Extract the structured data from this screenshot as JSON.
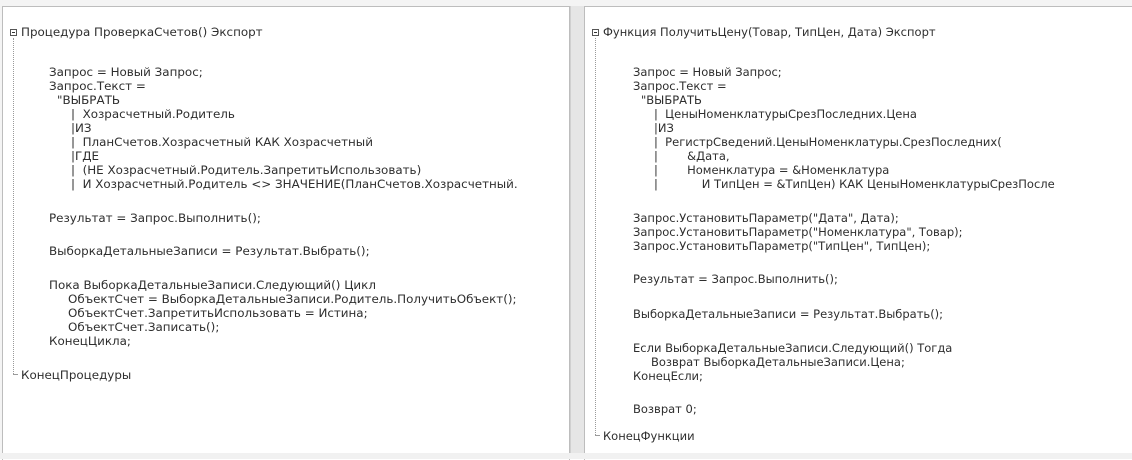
{
  "left_pane": {
    "lines": [
      {
        "text": "Процедура ПроверкаСчетов() Экспорт"
      },
      {
        "text": ""
      },
      {
        "text": "Запрос = Новый Запрос;"
      },
      {
        "text": "Запрос.Текст ="
      },
      {
        "text": "\"ВЫБРАТЬ"
      },
      {
        "text": "|  Хозрасчетный.Родитель"
      },
      {
        "text": "|ИЗ"
      },
      {
        "text": "|  ПланСчетов.Хозрасчетный КАК Хозрасчетный"
      },
      {
        "text": "|ГДЕ"
      },
      {
        "text": "|  (НЕ Хозрасчетный.Родитель.ЗапретитьИспользовать)"
      },
      {
        "text": "|  И Хозрасчетный.Родитель <> ЗНАЧЕНИЕ(ПланСчетов.Хозрасчетный."
      },
      {
        "text": ""
      },
      {
        "text": "Результат = Запрос.Выполнить();"
      },
      {
        "text": ""
      },
      {
        "text": "ВыборкаДетальныеЗаписи = Результат.Выбрать();"
      },
      {
        "text": ""
      },
      {
        "text": "Пока ВыборкаДетальныеЗаписи.Следующий() Цикл"
      },
      {
        "text": "ОбъектСчет = ВыборкаДетальныеЗаписи.Родитель.ПолучитьОбъект();"
      },
      {
        "text": "ОбъектСчет.ЗапретитьИспользовать = Истина;"
      },
      {
        "text": "ОбъектСчет.Записать();"
      },
      {
        "text": "КонецЦикла;"
      },
      {
        "text": ""
      },
      {
        "text": "КонецПроцедуры"
      }
    ]
  },
  "right_pane": {
    "lines": [
      {
        "text": "Функция ПолучитьЦену(Товар, ТипЦен, Дата) Экспорт"
      },
      {
        "text": ""
      },
      {
        "text": "Запрос = Новый Запрос;"
      },
      {
        "text": "Запрос.Текст ="
      },
      {
        "text": "\"ВЫБРАТЬ"
      },
      {
        "text": "|  ЦеныНоменклатурыСрезПоследних.Цена"
      },
      {
        "text": "|ИЗ"
      },
      {
        "text": "|  РегистрСведений.ЦеныНоменклатуры.СрезПоследних("
      },
      {
        "text": "|        &Дата,"
      },
      {
        "text": "|        Номенклатура = &Номенклатура"
      },
      {
        "text": "|            И ТипЦен = &ТипЦен) КАК ЦеныНоменклатурыСрезПосле"
      },
      {
        "text": ""
      },
      {
        "text": "Запрос.УстановитьПараметр(\"Дата\", Дата);"
      },
      {
        "text": "Запрос.УстановитьПараметр(\"Номенклатура\", Товар);"
      },
      {
        "text": "Запрос.УстановитьПараметр(\"ТипЦен\", ТипЦен);"
      },
      {
        "text": ""
      },
      {
        "text": "Результат = Запрос.Выполнить();"
      },
      {
        "text": ""
      },
      {
        "text": "ВыборкаДетальныеЗаписи = Результат.Выбрать();"
      },
      {
        "text": ""
      },
      {
        "text": "Если ВыборкаДетальныеЗаписи.Следующий() Тогда"
      },
      {
        "text": "Возврат ВыборкаДетальныеЗаписи.Цена;"
      },
      {
        "text": "КонецЕсли;"
      },
      {
        "text": ""
      },
      {
        "text": "Возврат 0;"
      },
      {
        "text": ""
      },
      {
        "text": "КонецФункции"
      }
    ]
  },
  "icons": {
    "fold_open": "minus-box-icon",
    "fold_end": "fold-end-icon"
  },
  "colors": {
    "background": "#ffffff",
    "text": "#2e2e2e",
    "divider": "#e6e6e6"
  }
}
